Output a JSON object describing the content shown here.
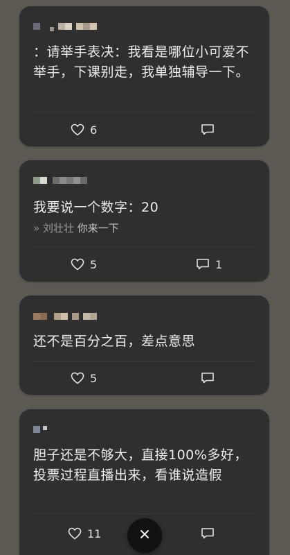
{
  "comments": [
    {
      "text": "：请举手表决：我看是哪位小可爱不举手，下课别走，我单独辅导一下。",
      "likes": "6",
      "replies": ""
    },
    {
      "text": "我要说一个数字：20",
      "reply_arrow": "»",
      "reply_name": "刘壮壮",
      "reply_text": "你来一下",
      "likes": "5",
      "replies": "1"
    },
    {
      "text": "还不是百分之百，差点意思",
      "likes": "5",
      "replies": ""
    },
    {
      "text": "胆子还是不够大，直接100%多好，投票过程直播出来，看谁说造假",
      "likes": "11",
      "replies": ""
    }
  ],
  "icons": {
    "like": "heart-icon",
    "comment": "comment-icon",
    "close": "close-icon"
  },
  "colors": {
    "background": "#5b5952",
    "card": "#2f2f2f",
    "text": "#ececec",
    "close_button": "#111111"
  }
}
